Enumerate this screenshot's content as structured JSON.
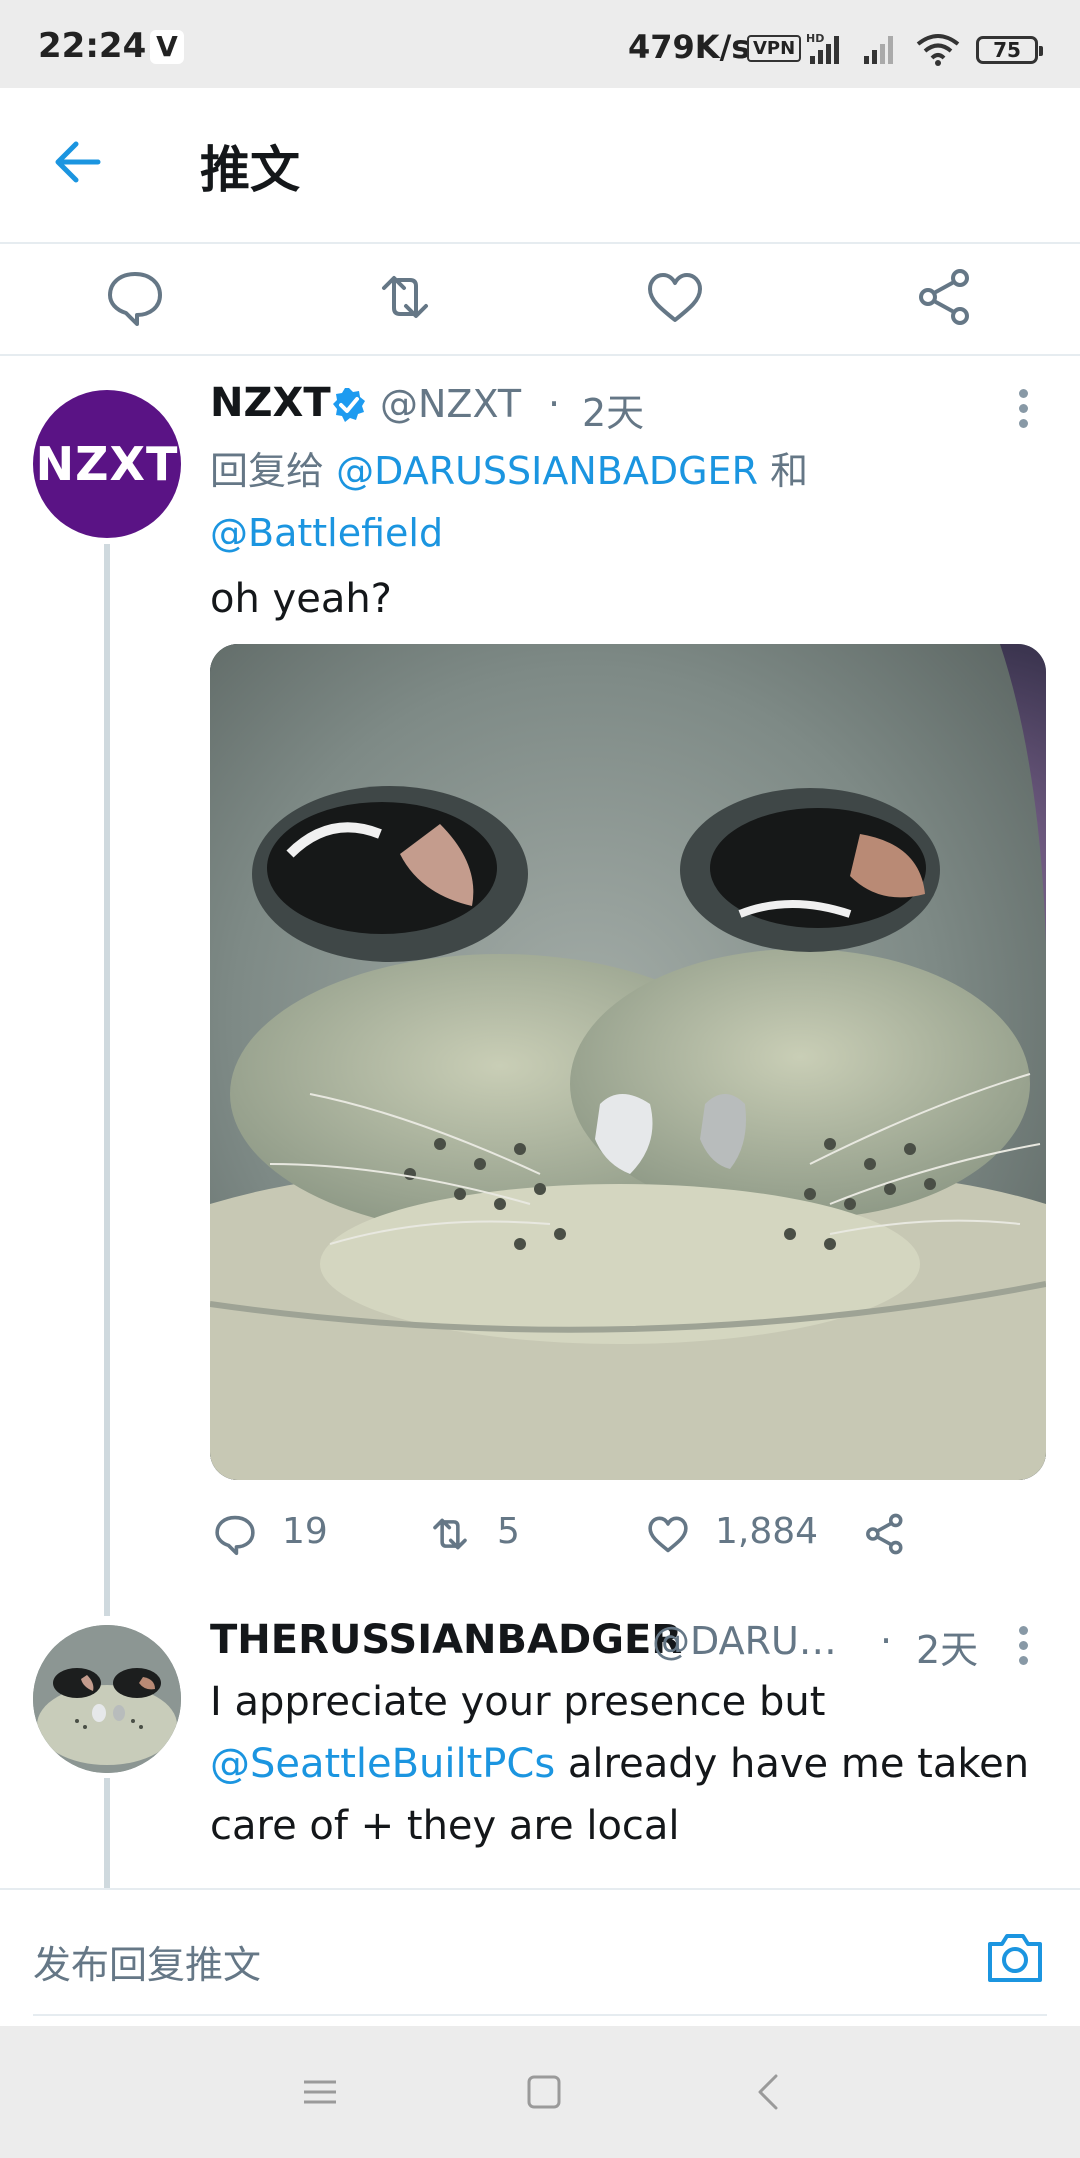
{
  "status_bar": {
    "time": "22:24",
    "app_badge": "V",
    "network_speed": "479K/s",
    "vpn_label": "VPN",
    "hd_label": "HD",
    "battery": "75"
  },
  "header": {
    "title": "推文",
    "back_icon": "arrow-left-icon"
  },
  "action_row": {
    "icons": [
      "reply-icon",
      "retweet-icon",
      "like-icon",
      "share-icon"
    ]
  },
  "tweet_main": {
    "author": "NZXT",
    "avatar_text": "NZXT",
    "verified": true,
    "handle": "@NZXT",
    "separator": "·",
    "time": "2天",
    "reply_prefix": "回复给",
    "reply_mention_1": "@DARUSSIANBADGER",
    "reply_and": "和",
    "reply_mention_2": "@Battlefield",
    "text": "oh yeah?",
    "stats": {
      "replies": "19",
      "retweets": "5",
      "likes": "1,884"
    }
  },
  "tweet_reply": {
    "author": "THERUSSIANBADGER",
    "handle": "@DARU…",
    "separator": "·",
    "time": "2天",
    "text_1": "I appreciate your presence but",
    "mention": "@SeattleBuiltPCs",
    "text_2": " already have me taken",
    "text_3": "care of + they are local"
  },
  "compose": {
    "placeholder": "发布回复推文",
    "camera_icon": "camera-icon"
  },
  "colors": {
    "accent": "#1b95e0",
    "text_primary": "#14171a",
    "text_secondary": "#657786",
    "divider": "#e6ecf0",
    "nzxt_purple": "#5a1385"
  }
}
